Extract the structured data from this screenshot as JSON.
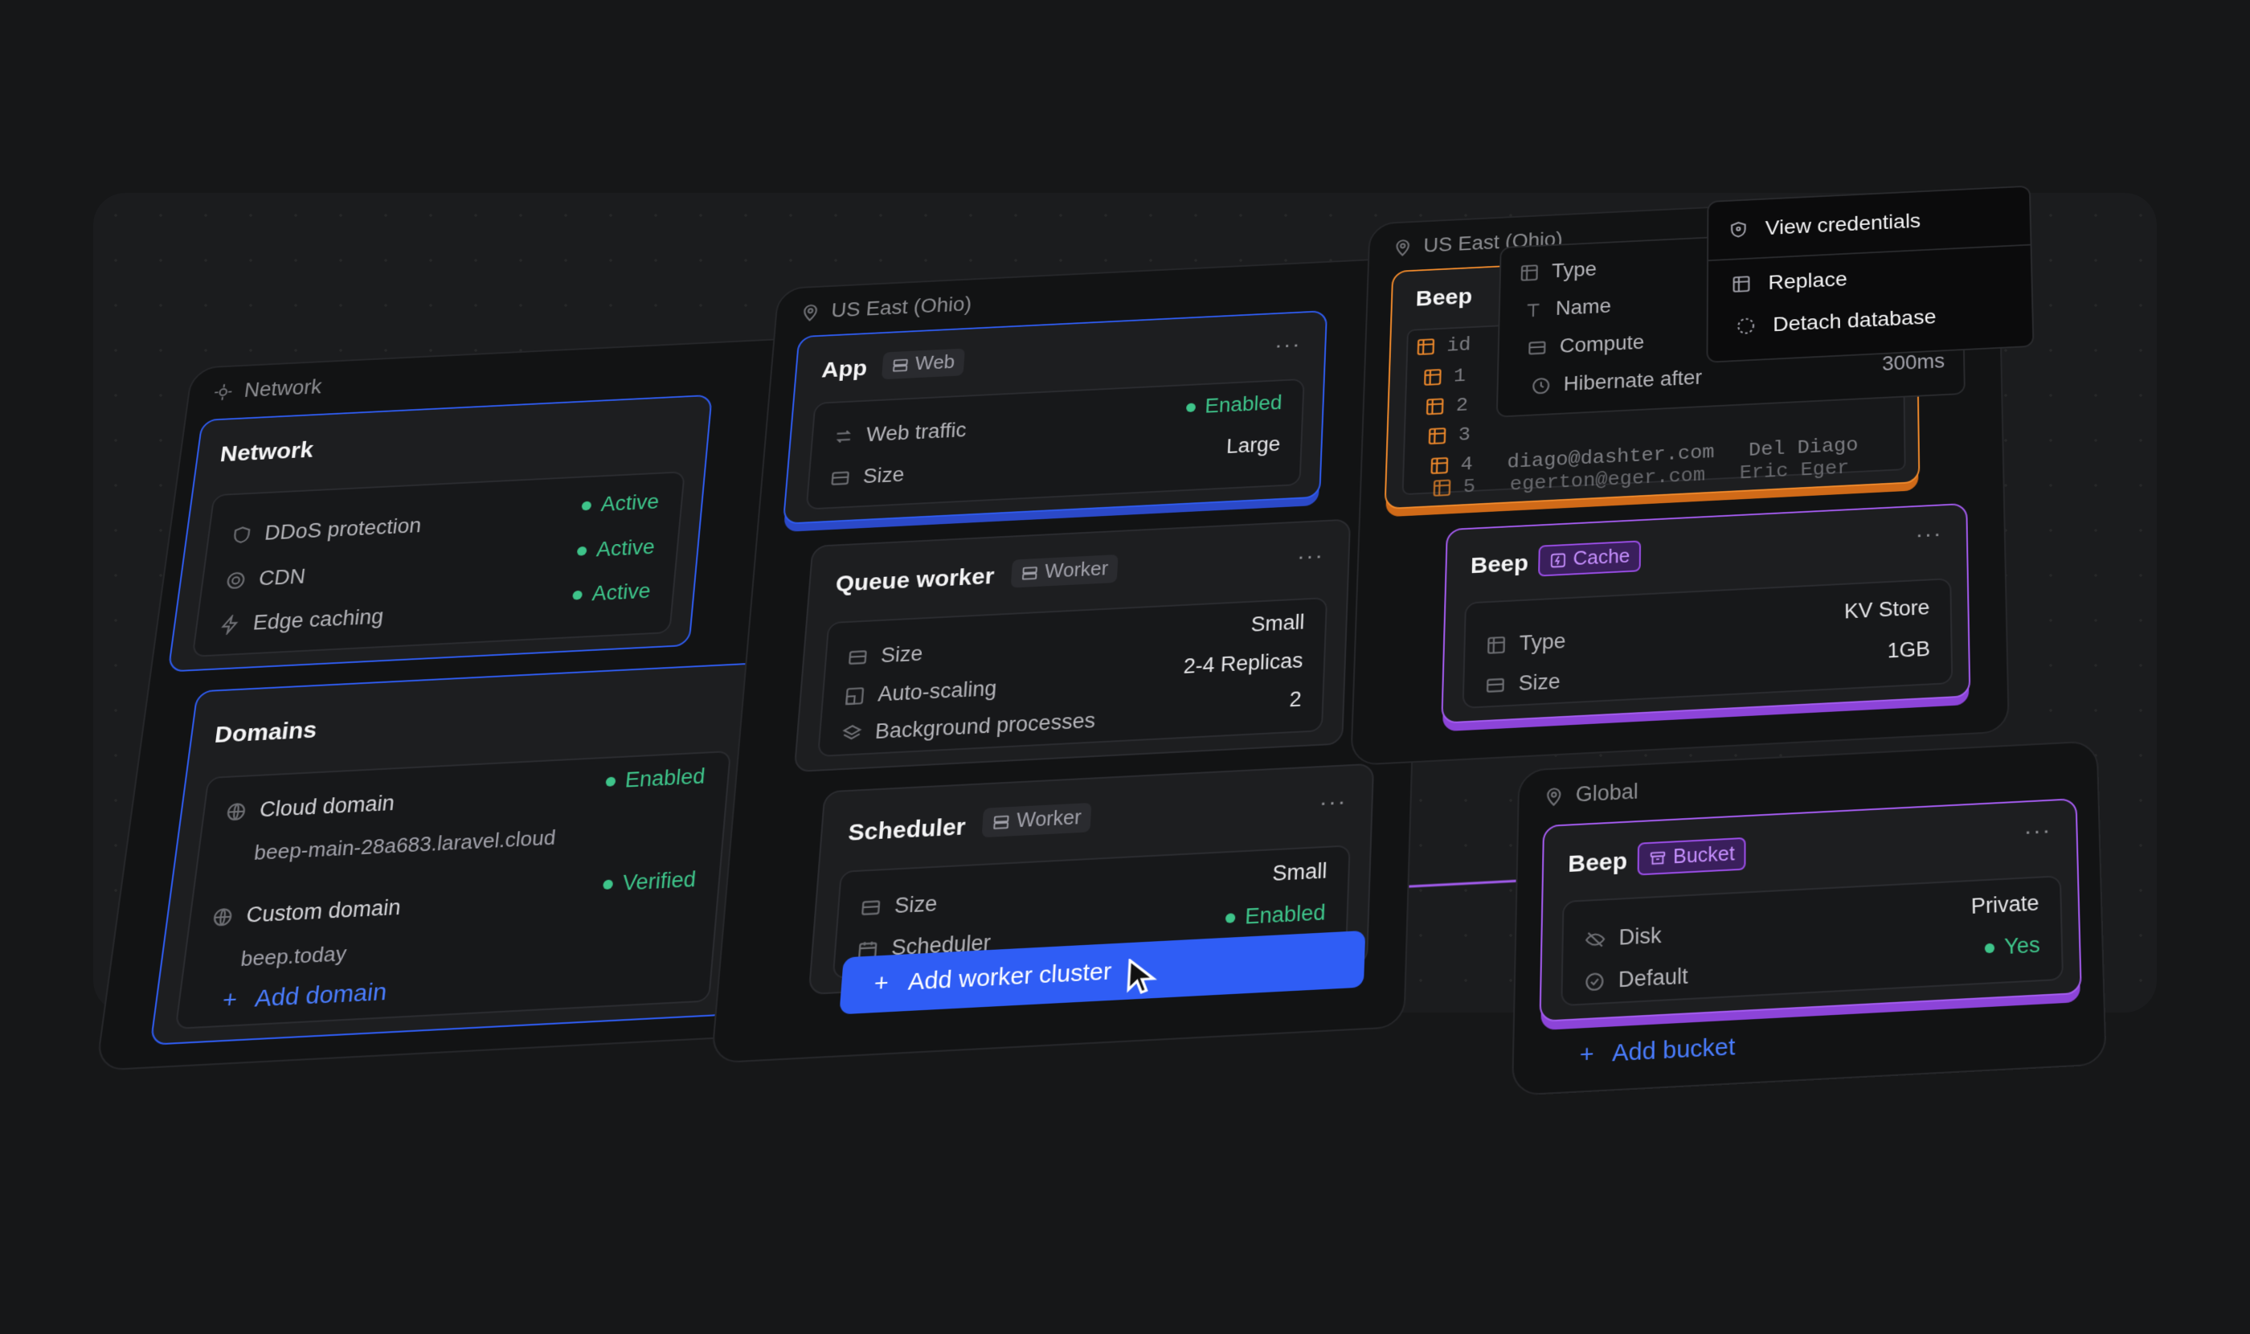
{
  "network_column": {
    "header": "Network",
    "network_card": {
      "title": "Network",
      "items": [
        {
          "label": "DDoS protection",
          "status": "Active",
          "icon": "shield-icon"
        },
        {
          "label": "CDN",
          "status": "Active",
          "icon": "cdn-icon"
        },
        {
          "label": "Edge caching",
          "status": "Active",
          "icon": "lightning-icon"
        }
      ]
    },
    "domains_card": {
      "title": "Domains",
      "cloud_domain": {
        "label": "Cloud domain",
        "status": "Enabled",
        "value": "beep-main-28a683.laravel.cloud"
      },
      "custom_domain": {
        "label": "Custom domain",
        "status": "Verified",
        "value": "beep.today"
      },
      "add_label": "Add domain"
    }
  },
  "compute_column": {
    "header": "US East (Ohio)",
    "app_card": {
      "title": "App",
      "tag": "Web",
      "rows": [
        {
          "label": "Web traffic",
          "value": "Enabled"
        },
        {
          "label": "Size",
          "value": "Large"
        }
      ]
    },
    "queue_card": {
      "title": "Queue worker",
      "tag": "Worker",
      "rows": [
        {
          "label": "Size",
          "value": "Small"
        },
        {
          "label": "Auto-scaling",
          "value": "2-4 Replicas"
        },
        {
          "label": "Background processes",
          "value": "2"
        }
      ]
    },
    "scheduler_card": {
      "title": "Scheduler",
      "tag": "Worker",
      "rows": [
        {
          "label": "Size",
          "value": "Small"
        },
        {
          "label": "Scheduler",
          "value": "Enabled"
        }
      ]
    },
    "add_worker_label": "Add worker cluster",
    "more": "..."
  },
  "resources_column": {
    "header": "US East (Ohio)",
    "db_card": {
      "title": "Beep",
      "table_header": "id",
      "row_ids": [
        "1",
        "2",
        "3",
        "4",
        "5"
      ],
      "emails": [
        "diago@dashter.com",
        "egerton@eger.com"
      ],
      "names": [
        "Del Diago",
        "Eric Eger"
      ],
      "details_menu": [
        {
          "label": "Type",
          "icon": "table-icon"
        },
        {
          "label": "Name",
          "icon": "text-icon"
        },
        {
          "label": "Compute",
          "icon": "server-icon"
        },
        {
          "label": "Hibernate after",
          "icon": "clock-icon"
        }
      ],
      "hibernate_value": "300ms"
    },
    "context_menu": [
      {
        "label": "View credentials",
        "icon": "shield-key-icon"
      },
      {
        "label": "Replace",
        "icon": "table-icon"
      },
      {
        "label": "Detach database",
        "icon": "detach-icon"
      }
    ],
    "cache_card": {
      "title": "Beep",
      "tag": "Cache",
      "rows": [
        {
          "label": "Type",
          "value": "KV Store"
        },
        {
          "label": "Size",
          "value": "1GB"
        }
      ]
    }
  },
  "global_column": {
    "header": "Global",
    "bucket_card": {
      "title": "Beep",
      "tag": "Bucket",
      "rows": [
        {
          "label": "Disk",
          "value": "Private"
        },
        {
          "label": "Default",
          "value": "Yes"
        }
      ]
    },
    "add_label": "Add bucket"
  },
  "colors": {
    "blue": "#2f5cf0",
    "orange": "#f08a2c",
    "purple": "#a45cf0",
    "green": "#3ec48a"
  }
}
